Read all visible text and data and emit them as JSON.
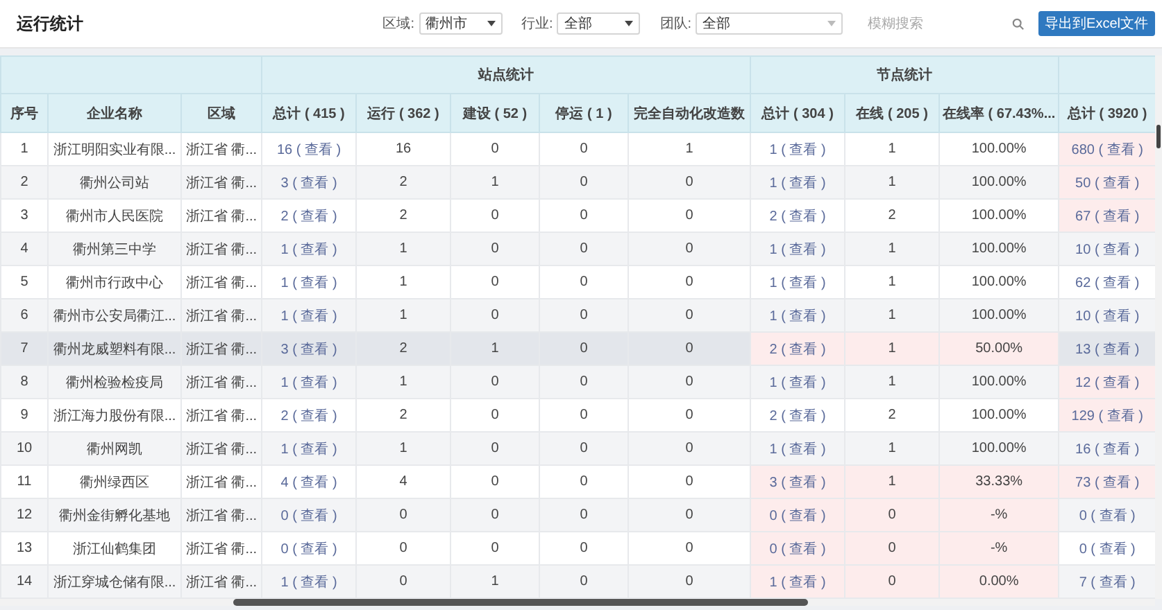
{
  "title": "运行统计",
  "filters": [
    {
      "label": "区域:",
      "value": "衢州市",
      "kind": "select"
    },
    {
      "label": "行业:",
      "value": "全部",
      "kind": "select"
    },
    {
      "label": "团队:",
      "value": "全部",
      "kind": "select-wide"
    }
  ],
  "search": {
    "placeholder": "模糊搜索"
  },
  "export_button": "导出到Excel文件",
  "table": {
    "header_groups": [
      {
        "columns": [
          {
            "label": "序号",
            "kind": "text"
          },
          {
            "label": "企业名称",
            "kind": "text"
          },
          {
            "label": "区域",
            "kind": "text"
          }
        ]
      },
      {
        "label": "站点统计",
        "columns": [
          {
            "label": "总计 ( 415 )",
            "kind": "link"
          },
          {
            "label": "运行 ( 362 )",
            "kind": "text"
          },
          {
            "label": "建设 ( 52 )",
            "kind": "text"
          },
          {
            "label": "停运 ( 1 )",
            "kind": "text"
          },
          {
            "label": "完全自动化改造数",
            "kind": "text"
          }
        ]
      },
      {
        "label": "节点统计",
        "columns": [
          {
            "label": "总计 ( 304 )",
            "kind": "node-link"
          },
          {
            "label": "在线 ( 205 )",
            "kind": "node"
          },
          {
            "label": "在线率 ( 67.43%...",
            "kind": "node"
          }
        ]
      },
      {
        "columns": [
          {
            "label": "总计 ( 3920 )",
            "kind": "total-link"
          }
        ]
      }
    ],
    "rows": [
      {
        "cells": [
          "1",
          "浙江明阳实业有限...",
          "浙江省 衢...",
          "16 ( 查看 )",
          "16",
          "0",
          "0",
          "1",
          "1 ( 查看 )",
          "1",
          "100.00%",
          "680 ( 查看 )"
        ],
        "node_alert": false,
        "total_alert": true,
        "highlighted": false
      },
      {
        "cells": [
          "2",
          "衢州公司站",
          "浙江省 衢...",
          "3 ( 查看 )",
          "2",
          "1",
          "0",
          "0",
          "1 ( 查看 )",
          "1",
          "100.00%",
          "50 ( 查看 )"
        ],
        "node_alert": false,
        "total_alert": true,
        "highlighted": false
      },
      {
        "cells": [
          "3",
          "衢州市人民医院",
          "浙江省 衢...",
          "2 ( 查看 )",
          "2",
          "0",
          "0",
          "0",
          "2 ( 查看 )",
          "2",
          "100.00%",
          "67 ( 查看 )"
        ],
        "node_alert": false,
        "total_alert": true,
        "highlighted": false
      },
      {
        "cells": [
          "4",
          "衢州第三中学",
          "浙江省 衢...",
          "1 ( 查看 )",
          "1",
          "0",
          "0",
          "0",
          "1 ( 查看 )",
          "1",
          "100.00%",
          "10 ( 查看 )"
        ],
        "node_alert": false,
        "total_alert": false,
        "highlighted": false
      },
      {
        "cells": [
          "5",
          "衢州市行政中心",
          "浙江省 衢...",
          "1 ( 查看 )",
          "1",
          "0",
          "0",
          "0",
          "1 ( 查看 )",
          "1",
          "100.00%",
          "62 ( 查看 )"
        ],
        "node_alert": false,
        "total_alert": false,
        "highlighted": false
      },
      {
        "cells": [
          "6",
          "衢州市公安局衢江...",
          "浙江省 衢...",
          "1 ( 查看 )",
          "1",
          "0",
          "0",
          "0",
          "1 ( 查看 )",
          "1",
          "100.00%",
          "10 ( 查看 )"
        ],
        "node_alert": false,
        "total_alert": false,
        "highlighted": false
      },
      {
        "cells": [
          "7",
          "衢州龙威塑料有限...",
          "浙江省 衢...",
          "3 ( 查看 )",
          "2",
          "1",
          "0",
          "0",
          "2 ( 查看 )",
          "1",
          "50.00%",
          "13 ( 查看 )"
        ],
        "node_alert": true,
        "total_alert": false,
        "highlighted": true
      },
      {
        "cells": [
          "8",
          "衢州检验检疫局",
          "浙江省 衢...",
          "1 ( 查看 )",
          "1",
          "0",
          "0",
          "0",
          "1 ( 查看 )",
          "1",
          "100.00%",
          "12 ( 查看 )"
        ],
        "node_alert": false,
        "total_alert": true,
        "highlighted": false
      },
      {
        "cells": [
          "9",
          "浙江海力股份有限...",
          "浙江省 衢...",
          "2 ( 查看 )",
          "2",
          "0",
          "0",
          "0",
          "2 ( 查看 )",
          "2",
          "100.00%",
          "129 ( 查看 )"
        ],
        "node_alert": false,
        "total_alert": true,
        "highlighted": false
      },
      {
        "cells": [
          "10",
          "衢州网凯",
          "浙江省 衢...",
          "1 ( 查看 )",
          "1",
          "0",
          "0",
          "0",
          "1 ( 查看 )",
          "1",
          "100.00%",
          "16 ( 查看 )"
        ],
        "node_alert": false,
        "total_alert": false,
        "highlighted": false
      },
      {
        "cells": [
          "11",
          "衢州绿西区",
          "浙江省 衢...",
          "4 ( 查看 )",
          "4",
          "0",
          "0",
          "0",
          "3 ( 查看 )",
          "1",
          "33.33%",
          "73 ( 查看 )"
        ],
        "node_alert": true,
        "total_alert": true,
        "highlighted": false
      },
      {
        "cells": [
          "12",
          "衢州金街孵化基地",
          "浙江省 衢...",
          "0 ( 查看 )",
          "0",
          "0",
          "0",
          "0",
          "0 ( 查看 )",
          "0",
          "-%",
          "0 ( 查看 )"
        ],
        "node_alert": true,
        "total_alert": false,
        "highlighted": false
      },
      {
        "cells": [
          "13",
          "浙江仙鹤集团",
          "浙江省 衢...",
          "0 ( 查看 )",
          "0",
          "0",
          "0",
          "0",
          "0 ( 查看 )",
          "0",
          "-%",
          "0 ( 查看 )"
        ],
        "node_alert": true,
        "total_alert": false,
        "highlighted": false
      },
      {
        "cells": [
          "14",
          "浙江穿城仓储有限...",
          "浙江省 衢...",
          "1 ( 查看 )",
          "0",
          "1",
          "0",
          "0",
          "1 ( 查看 )",
          "0",
          "0.00%",
          "7 ( 查看 )"
        ],
        "node_alert": true,
        "total_alert": false,
        "highlighted": false
      }
    ]
  }
}
